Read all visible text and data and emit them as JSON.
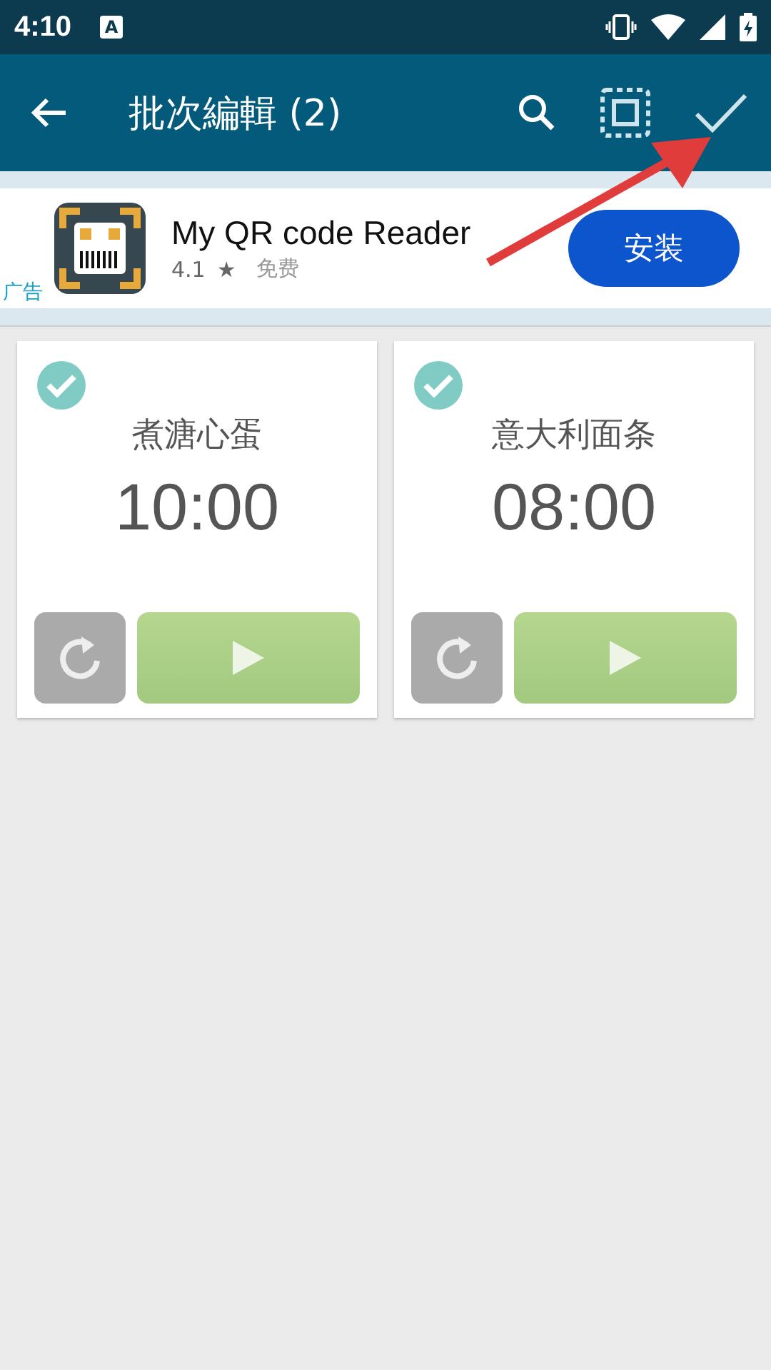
{
  "status_bar": {
    "time": "4:10",
    "notification": "A"
  },
  "toolbar": {
    "title": "批次編輯 (2)"
  },
  "ad": {
    "app_name": "My QR code Reader",
    "rating": "4.1",
    "star": "★",
    "price": "免费",
    "label": "广告",
    "button": "安装"
  },
  "timers": [
    {
      "name": "煮溏心蛋",
      "time": "10:00",
      "selected": true
    },
    {
      "name": "意大利面条",
      "time": "08:00",
      "selected": true
    }
  ]
}
